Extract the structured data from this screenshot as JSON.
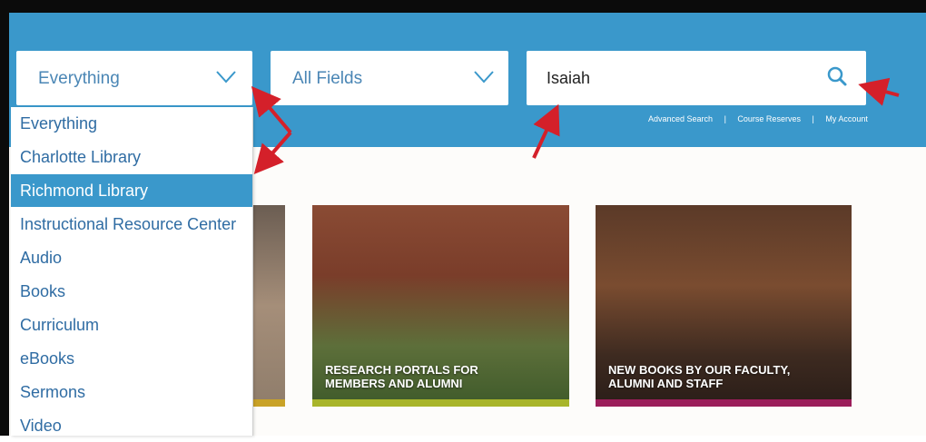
{
  "search": {
    "scope_selected": "Everything",
    "field_selected": "All Fields",
    "query_value": "Isaiah"
  },
  "header_links": [
    "Advanced Search",
    "Course Reserves",
    "My Account"
  ],
  "scope_options": [
    {
      "label": "Everything",
      "selected": false
    },
    {
      "label": "Charlotte Library",
      "selected": false
    },
    {
      "label": "Richmond Library",
      "selected": true
    },
    {
      "label": "Instructional Resource Center",
      "selected": false
    },
    {
      "label": "Audio",
      "selected": false
    },
    {
      "label": "Books",
      "selected": false
    },
    {
      "label": "Curriculum",
      "selected": false
    },
    {
      "label": "eBooks",
      "selected": false
    },
    {
      "label": "Sermons",
      "selected": false
    },
    {
      "label": "Video",
      "selected": false
    }
  ],
  "cards": {
    "research": {
      "line1": "RESEARCH PORTALS FOR",
      "line2": "MEMBERS AND ALUMNI"
    },
    "books": {
      "line1": "NEW BOOKS BY OUR FACULTY,",
      "line2": "ALUMNI AND STAFF"
    }
  },
  "colors": {
    "header_blue": "#3a98cb",
    "accent_red": "#d4202a",
    "card_bar_gold": "#c9a227",
    "card_bar_olive": "#a8b52a",
    "card_bar_magenta": "#9b1d5a"
  }
}
